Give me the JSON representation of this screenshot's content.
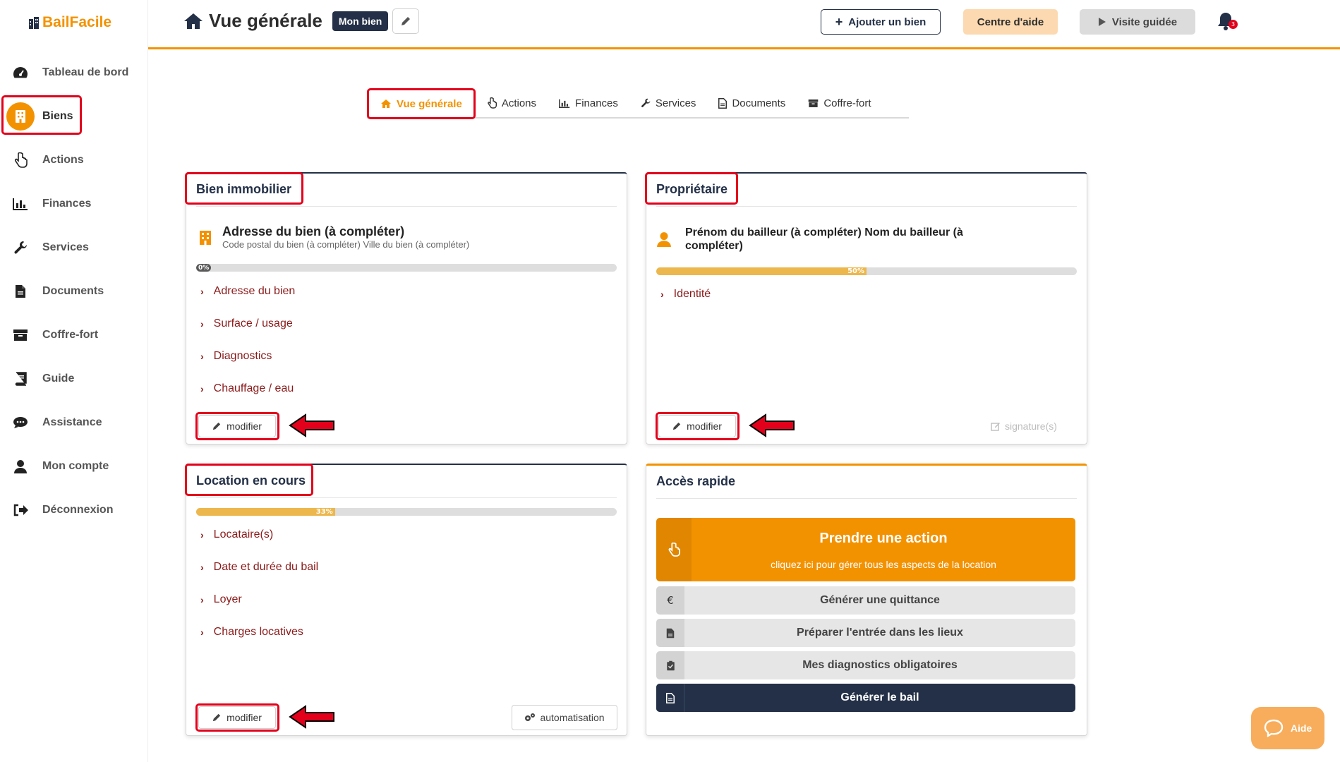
{
  "app": {
    "logo": "BailFacile"
  },
  "sidebar": {
    "items": [
      {
        "label": "Tableau de bord",
        "icon": "dashboard-icon"
      },
      {
        "label": "Biens",
        "icon": "building-icon"
      },
      {
        "label": "Actions",
        "icon": "hand-pointer-icon"
      },
      {
        "label": "Finances",
        "icon": "chart-icon"
      },
      {
        "label": "Services",
        "icon": "wrench-icon"
      },
      {
        "label": "Documents",
        "icon": "document-icon"
      },
      {
        "label": "Coffre-fort",
        "icon": "archive-icon"
      },
      {
        "label": "Guide",
        "icon": "book-icon"
      },
      {
        "label": "Assistance",
        "icon": "chat-icon"
      },
      {
        "label": "Mon compte",
        "icon": "user-icon"
      },
      {
        "label": "Déconnexion",
        "icon": "logout-icon"
      }
    ],
    "active": "Biens"
  },
  "header": {
    "title": "Vue générale",
    "badge": "Mon bien",
    "add_label": "Ajouter un bien",
    "help_label": "Centre d'aide",
    "visit_label": "Visite guidée",
    "notif_count": "3"
  },
  "tabs": [
    {
      "label": "Vue générale",
      "icon": "home-icon"
    },
    {
      "label": "Actions",
      "icon": "hand-pointer-icon"
    },
    {
      "label": "Finances",
      "icon": "chart-icon"
    },
    {
      "label": "Services",
      "icon": "wrench-icon"
    },
    {
      "label": "Documents",
      "icon": "document-icon"
    },
    {
      "label": "Coffre-fort",
      "icon": "archive-icon"
    }
  ],
  "bien": {
    "title": "Bien immobilier",
    "address": "Adresse du bien (à compléter)",
    "address_sub": "Code postal du bien (à compléter) Ville du bien (à compléter)",
    "progress": 0,
    "progress_label": "0%",
    "links": [
      "Adresse du bien",
      "Surface / usage",
      "Diagnostics",
      "Chauffage / eau"
    ],
    "modify_label": "modifier"
  },
  "proprietaire": {
    "title": "Propriétaire",
    "name": "Prénom du bailleur (à compléter) Nom du bailleur (à compléter)",
    "progress": 50,
    "progress_label": "50%",
    "links": [
      "Identité"
    ],
    "modify_label": "modifier",
    "signature_label": "signature(s)"
  },
  "location": {
    "title": "Location en cours",
    "progress": 33,
    "progress_label": "33%",
    "links": [
      "Locataire(s)",
      "Date et durée du bail",
      "Loyer",
      "Charges locatives"
    ],
    "modify_label": "modifier",
    "automation_label": "automatisation"
  },
  "acces": {
    "title": "Accès rapide",
    "main_title": "Prendre une action",
    "main_sub": "cliquez ici pour gérer tous les aspects de la location",
    "rows": [
      {
        "label": "Générer une quittance",
        "icon": "euro-icon"
      },
      {
        "label": "Préparer l'entrée dans les lieux",
        "icon": "file-icon"
      },
      {
        "label": "Mes diagnostics obligatoires",
        "icon": "clipboard-check-icon"
      },
      {
        "label": "Générer le bail",
        "icon": "file-text-icon"
      }
    ]
  },
  "aide": {
    "label": "Aide"
  },
  "colors": {
    "accent": "#f39200",
    "navy": "#233047",
    "highlight": "#e3001b",
    "link": "#8b1a1a"
  }
}
